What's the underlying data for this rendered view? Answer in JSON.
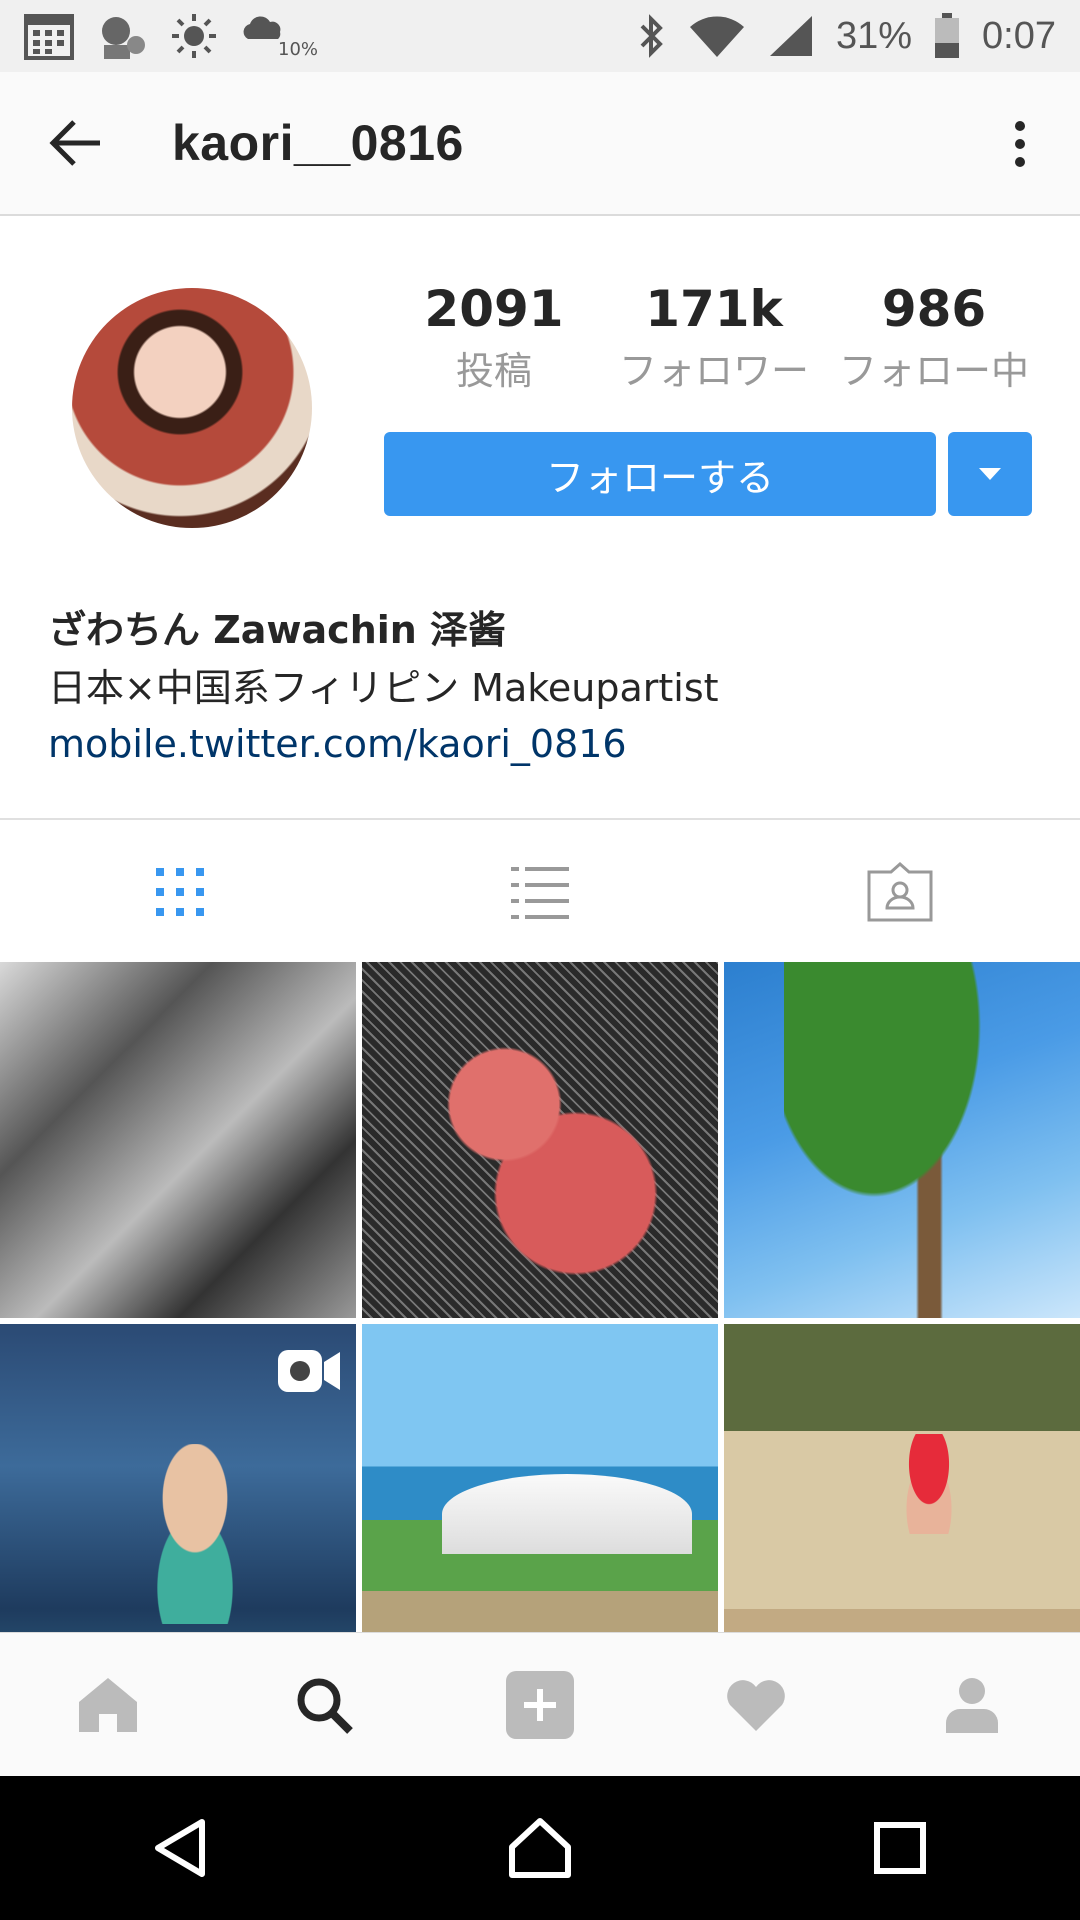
{
  "status_bar": {
    "weather_percent": "10%",
    "battery": "31%",
    "time": "0:07"
  },
  "header": {
    "username": "kaori__0816"
  },
  "profile": {
    "stats": [
      {
        "value": "2091",
        "label": "投稿"
      },
      {
        "value": "171k",
        "label": "フォロワー"
      },
      {
        "value": "986",
        "label": "フォロー中"
      }
    ],
    "follow_button": "フォローする",
    "display_name": "ざわちん Zawachin 泽酱",
    "bio": "日本×中国系フィリピン Makeupartist",
    "link": "mobile.twitter.com/kaori_0816"
  },
  "tabs": [
    {
      "icon": "grid-icon",
      "active": true
    },
    {
      "icon": "list-icon",
      "active": false
    },
    {
      "icon": "tagged-icon",
      "active": false
    }
  ],
  "posts": [
    {
      "type": "photo"
    },
    {
      "type": "photo"
    },
    {
      "type": "photo"
    },
    {
      "type": "video"
    },
    {
      "type": "photo"
    },
    {
      "type": "photo"
    }
  ],
  "bottom_nav": [
    "home-icon",
    "search-icon",
    "add-icon",
    "heart-icon",
    "profile-icon"
  ],
  "colors": {
    "accent": "#3897f0",
    "link": "#003569",
    "muted": "#999999"
  }
}
